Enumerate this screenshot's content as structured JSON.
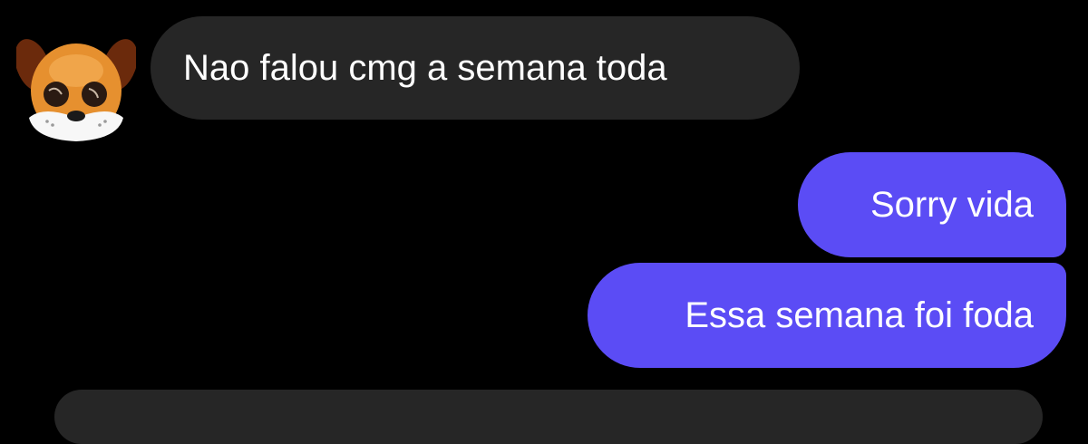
{
  "colors": {
    "background": "#000000",
    "received_bubble": "#262626",
    "sent_bubble": "#5b4cf5",
    "text": "#ffffff"
  },
  "contact": {
    "avatar_icon": "dog-filter-avatar-icon"
  },
  "messages": [
    {
      "direction": "received",
      "text": "Nao falou cmg a semana toda"
    },
    {
      "direction": "sent",
      "text": "Sorry vida"
    },
    {
      "direction": "sent",
      "text": "Essa semana foi foda"
    }
  ]
}
